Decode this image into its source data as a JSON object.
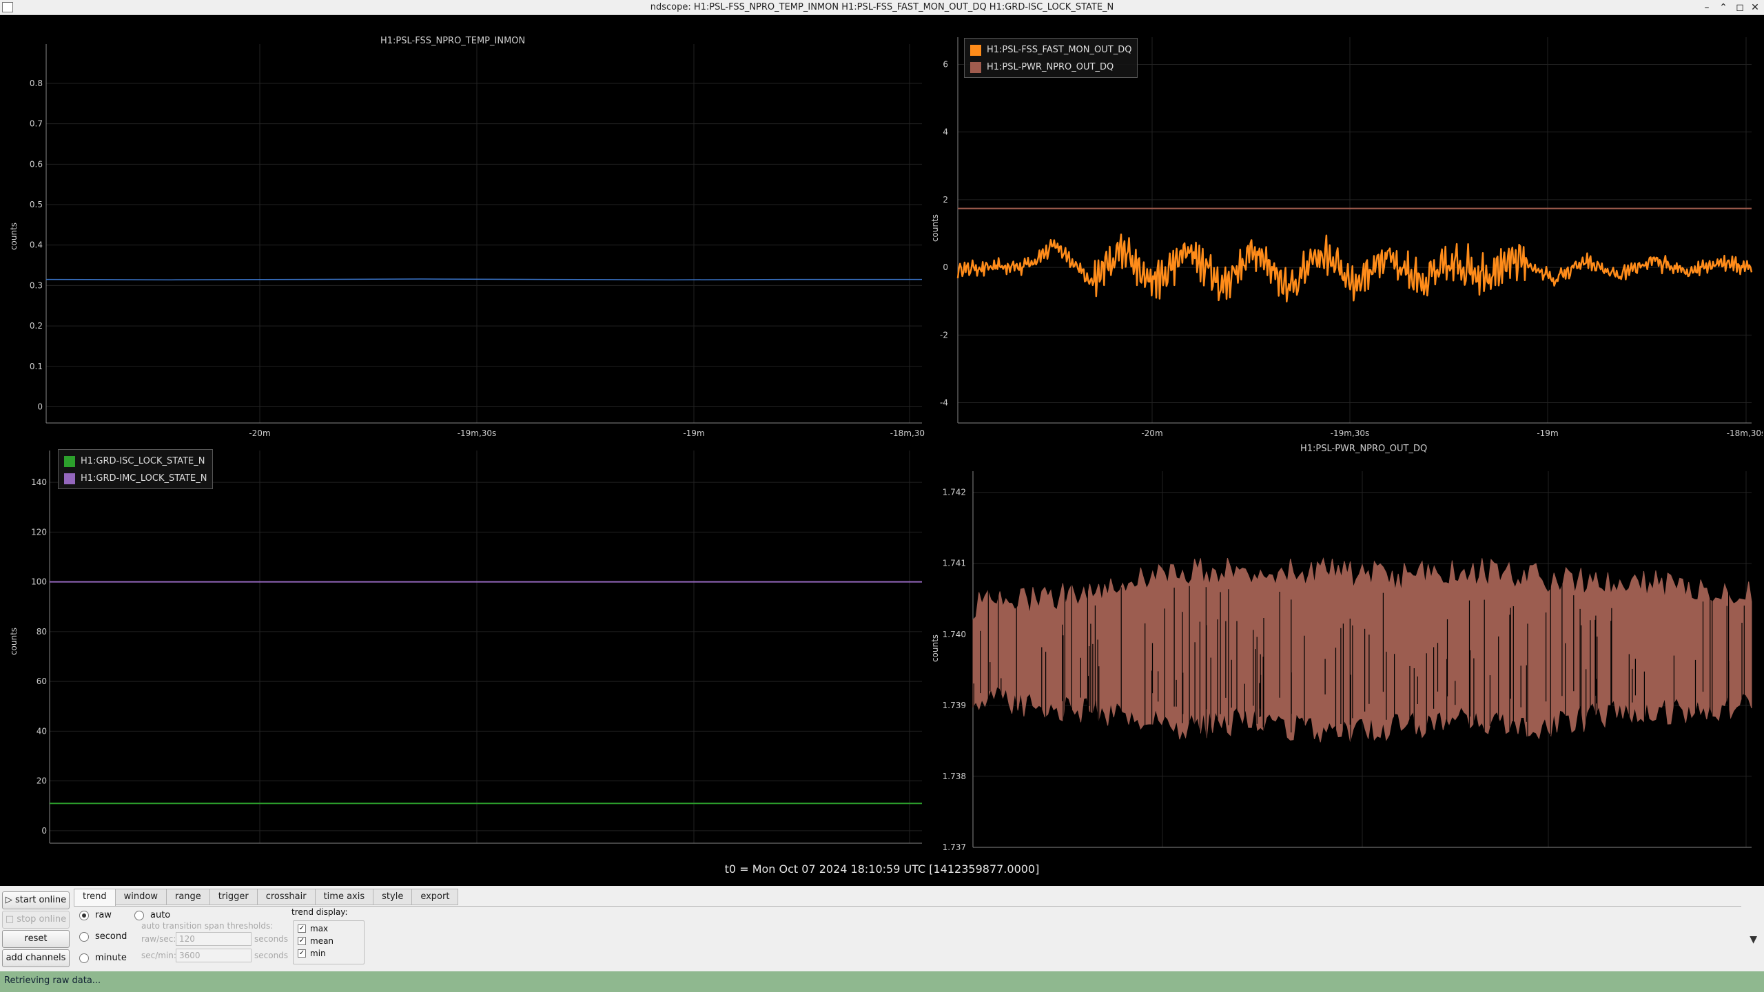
{
  "window": {
    "title": "ndscope: H1:PSL-FSS_NPRO_TEMP_INMON H1:PSL-FSS_FAST_MON_OUT_DQ H1:GRD-ISC_LOCK_STATE_N",
    "minimize_glyph": "–",
    "restore_glyph": "⌃",
    "maximize_glyph": "◻",
    "close_glyph": "✕"
  },
  "colors": {
    "temp_trace": "#3a74c8",
    "fast_mon": "#ff8c1a",
    "pwr_npro": "#a05c4e",
    "isc_lock": "#2ca02c",
    "imc_lock": "#9467bd",
    "pwr_fill": "#9c5d50",
    "status_bar": "#8fb88f"
  },
  "x_axis_ticks": [
    "-20m",
    "-19m,30s",
    "-19m",
    "-18m,30s"
  ],
  "plots": {
    "top_left": {
      "title": "H1:PSL-FSS_NPRO_TEMP_INMON",
      "ylabel": "counts",
      "y_ticks": [
        "0.8",
        "0.7",
        "0.6",
        "0.5",
        "0.4",
        "0.3",
        "0.2",
        "0.1",
        "0"
      ]
    },
    "top_right": {
      "ylabel": "counts",
      "y_ticks": [
        "6",
        "4",
        "2",
        "0",
        "-2",
        "-4"
      ],
      "legend": [
        "H1:PSL-FSS_FAST_MON_OUT_DQ",
        "H1:PSL-PWR_NPRO_OUT_DQ"
      ]
    },
    "bottom_left": {
      "ylabel": "counts",
      "y_ticks": [
        "140",
        "120",
        "100",
        "80",
        "60",
        "40",
        "20",
        "0"
      ],
      "legend": [
        "H1:GRD-ISC_LOCK_STATE_N",
        "H1:GRD-IMC_LOCK_STATE_N"
      ]
    },
    "bottom_right": {
      "title": "H1:PSL-PWR_NPRO_OUT_DQ",
      "ylabel": "counts",
      "y_ticks": [
        "1.742",
        "1.741",
        "1.740",
        "1.739",
        "1.738",
        "1.737"
      ]
    }
  },
  "chart_data": [
    {
      "type": "line",
      "title": "H1:PSL-FSS_NPRO_TEMP_INMON",
      "ylabel": "counts",
      "ylim": [
        -0.04,
        0.88
      ],
      "x_ticks": [
        "-20m",
        "-19m,30s",
        "-19m",
        "-18m,30s"
      ],
      "series": [
        {
          "name": "H1:PSL-FSS_NPRO_TEMP_INMON",
          "values": [
            0.315,
            0.314,
            0.315,
            0.316,
            0.315,
            0.314,
            0.315,
            0.315
          ]
        }
      ]
    },
    {
      "type": "line",
      "ylabel": "counts",
      "ylim": [
        -4.6,
        6.6
      ],
      "x_ticks": [
        "-20m",
        "-19m,30s",
        "-19m",
        "-18m,30s"
      ],
      "series": [
        {
          "name": "H1:PSL-FSS_FAST_MON_OUT_DQ",
          "values": [
            -0.1,
            0.0,
            0.1,
            1.5,
            -0.9,
            1.1,
            -1.0,
            1.2,
            -1.2,
            1.3,
            -1.3,
            1.0,
            -1.1,
            0.9,
            -0.9,
            0.3,
            -0.4,
            0.6,
            -0.8,
            0.4,
            -0.6,
            0.5,
            -0.3,
            0.4,
            0.0
          ]
        },
        {
          "name": "H1:PSL-PWR_NPRO_OUT_DQ",
          "values": [
            1.74,
            1.74
          ]
        }
      ]
    },
    {
      "type": "line",
      "ylabel": "counts",
      "ylim": [
        -5,
        150
      ],
      "x_ticks": [
        "-20m",
        "-19m,30s",
        "-19m",
        "-18m,30s"
      ],
      "series": [
        {
          "name": "H1:GRD-ISC_LOCK_STATE_N",
          "values": [
            11,
            11
          ]
        },
        {
          "name": "H1:GRD-IMC_LOCK_STATE_N",
          "values": [
            100,
            100
          ]
        }
      ]
    },
    {
      "type": "area",
      "title": "H1:PSL-PWR_NPRO_OUT_DQ",
      "ylabel": "counts",
      "ylim": [
        1.737,
        1.7422
      ],
      "x_ticks": [
        "-20m",
        "-19m,30s",
        "-19m",
        "-18m,30s"
      ],
      "series": [
        {
          "name": "max",
          "values": [
            1.7404,
            1.7405,
            1.7407,
            1.7409,
            1.7409,
            1.7409,
            1.7408,
            1.7409,
            1.7408,
            1.7407,
            1.7407,
            1.7406
          ]
        },
        {
          "name": "min",
          "values": [
            1.7391,
            1.739,
            1.7389,
            1.7387,
            1.7388,
            1.7386,
            1.7387,
            1.7388,
            1.7387,
            1.7389,
            1.7389,
            1.739
          ]
        }
      ]
    }
  ],
  "t0_label": "t0 = Mon Oct 07 2024 18:10:59 UTC [1412359877.0000]",
  "left_buttons": {
    "start_online": "start online",
    "stop_online": "stop online",
    "reset": "reset",
    "add_channels": "add channels"
  },
  "tabs": [
    "trend",
    "window",
    "range",
    "trigger",
    "crosshair",
    "time axis",
    "style",
    "export"
  ],
  "trend_tab": {
    "raw": "raw",
    "auto": "auto",
    "second": "second",
    "minute": "minute",
    "auto_title": "auto transition span thresholds:",
    "raw_sec_label": "raw/sec:",
    "raw_sec_value": "120",
    "sec_min_label": "sec/min:",
    "sec_min_value": "3600",
    "seconds_unit": "seconds",
    "trend_display_label": "trend display:",
    "max": "max",
    "mean": "mean",
    "min": "min"
  },
  "status": "Retrieving raw data..."
}
